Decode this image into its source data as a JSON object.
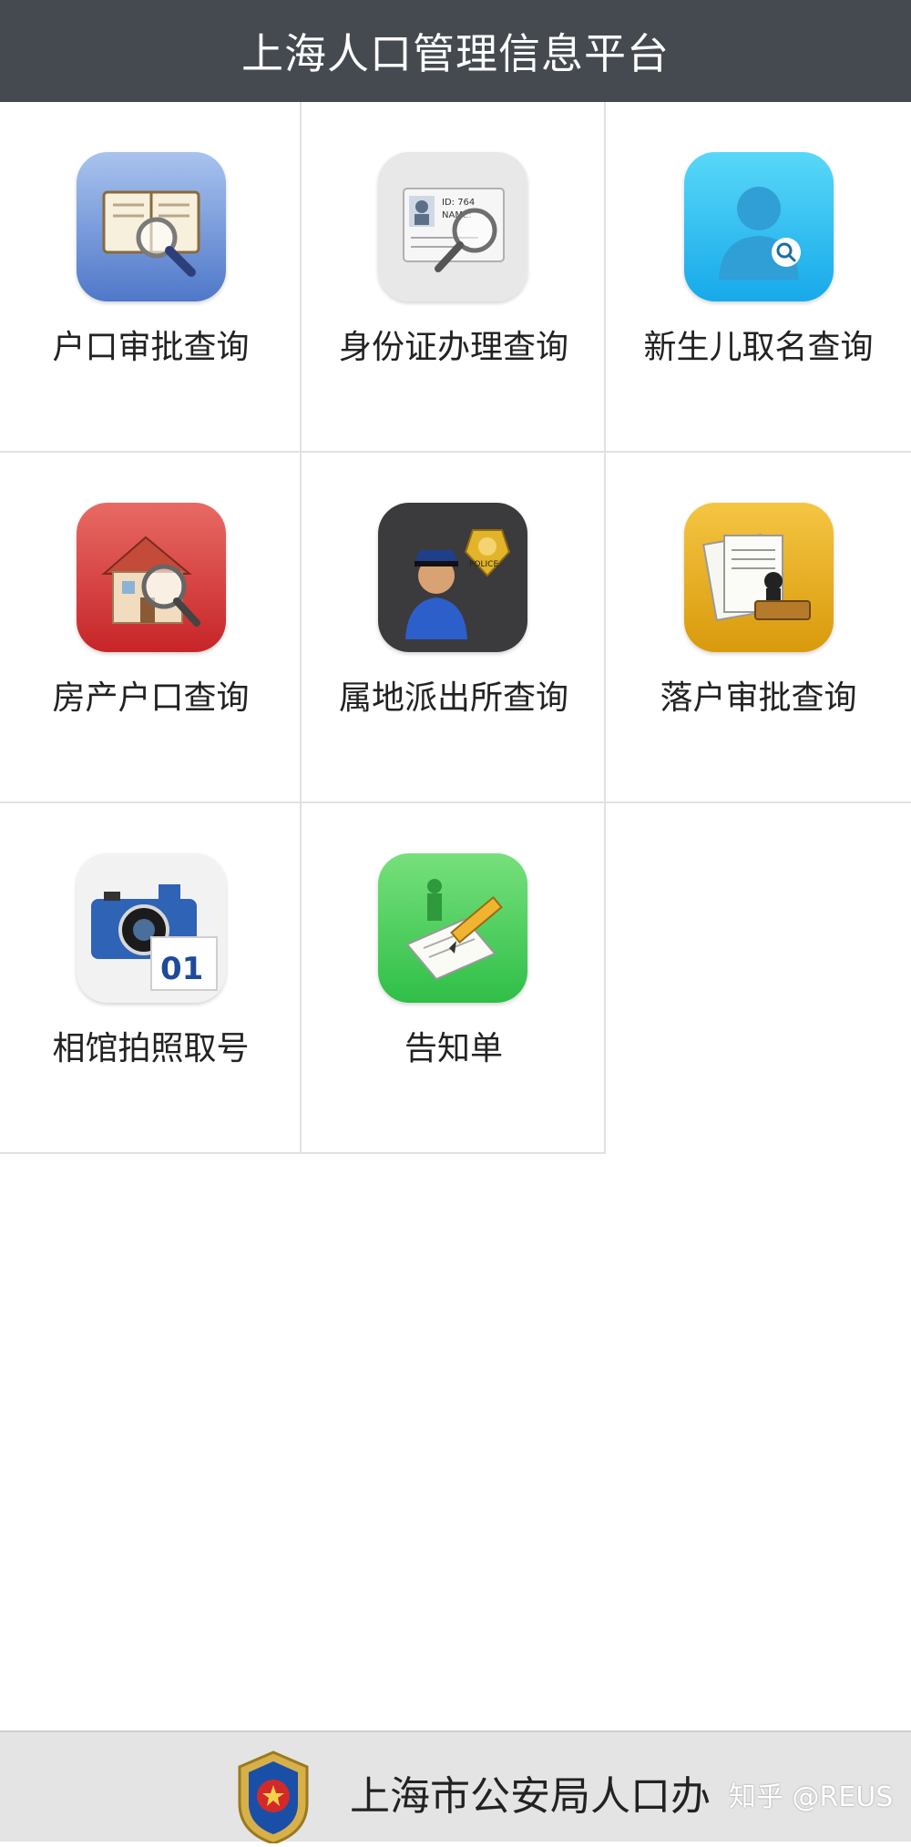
{
  "header": {
    "title": "上海人口管理信息平台"
  },
  "tiles": [
    {
      "label": "户口审批查询",
      "icon": "household-approval-search-icon"
    },
    {
      "label": "身份证办理查询",
      "icon": "id-card-search-icon"
    },
    {
      "label": "新生儿取名查询",
      "icon": "newborn-name-search-icon"
    },
    {
      "label": "房产户口查询",
      "icon": "house-household-search-icon"
    },
    {
      "label": "属地派出所查询",
      "icon": "police-station-icon"
    },
    {
      "label": "落户审批查询",
      "icon": "settlement-approval-stamp-icon"
    },
    {
      "label": "相馆拍照取号",
      "icon": "photo-studio-camera-icon"
    },
    {
      "label": "告知单",
      "icon": "notice-pencil-icon"
    }
  ],
  "icon_text": {
    "camera_number": "01",
    "police_badge": "POLICE",
    "id_card_number": "ID: 764",
    "id_card_name": "NAME:"
  },
  "footer": {
    "department": "上海市公安局人口办",
    "watermark": "知乎 @REUS"
  },
  "colors": {
    "header_bg": "#454a51",
    "footer_bg": "#e4e4e4",
    "grid_line": "#e1e1e1"
  }
}
